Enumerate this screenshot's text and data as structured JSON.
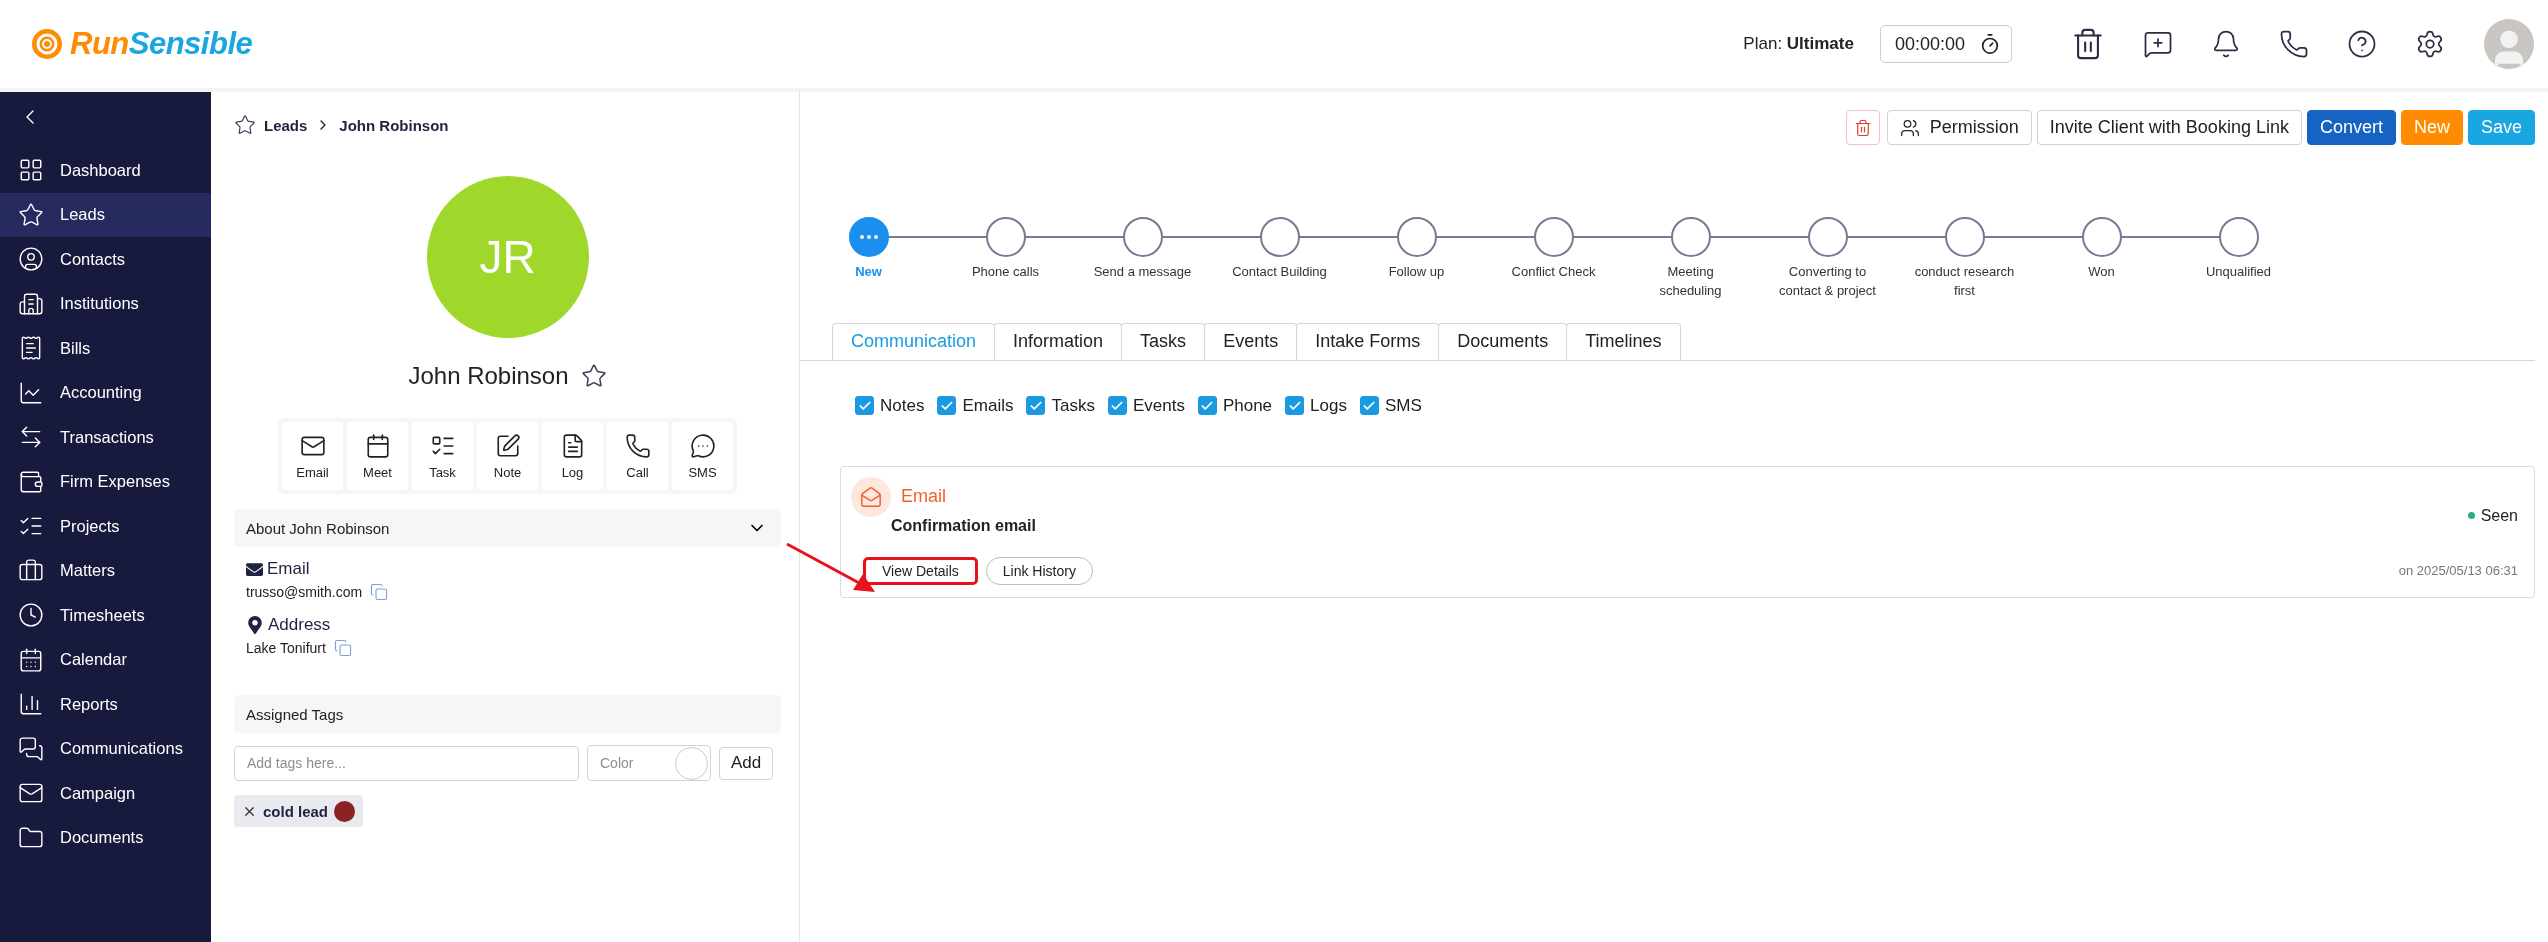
{
  "header": {
    "logo": {
      "part_1": "Run",
      "part_2": "Sensible"
    },
    "plan_label": "Plan:",
    "plan_name": "Ultimate",
    "timer": "00:00:00"
  },
  "sidebar": {
    "items": [
      {
        "label": "Dashboard",
        "selected": false
      },
      {
        "label": "Leads",
        "selected": true
      },
      {
        "label": "Contacts",
        "selected": false
      },
      {
        "label": "Institutions",
        "selected": false
      },
      {
        "label": "Bills",
        "selected": false
      },
      {
        "label": "Accounting",
        "selected": false
      },
      {
        "label": "Transactions",
        "selected": false
      },
      {
        "label": "Firm Expenses",
        "selected": false
      },
      {
        "label": "Projects",
        "selected": false
      },
      {
        "label": "Matters",
        "selected": false
      },
      {
        "label": "Timesheets",
        "selected": false
      },
      {
        "label": "Calendar",
        "selected": false
      },
      {
        "label": "Reports",
        "selected": false
      },
      {
        "label": "Communications",
        "selected": false
      },
      {
        "label": "Campaign",
        "selected": false
      },
      {
        "label": "Documents",
        "selected": false
      }
    ]
  },
  "breadcrumb": [
    "Leads",
    "John Robinson"
  ],
  "profile": {
    "initials": "JR",
    "name": "John Robinson",
    "favorite": false
  },
  "quick_actions": [
    "Email",
    "Meet",
    "Task",
    "Note",
    "Log",
    "Call",
    "SMS"
  ],
  "about": {
    "title": "About John Robinson",
    "expanded": true,
    "fields": [
      {
        "kind": "email",
        "label": "Email",
        "value": "trusso@smith.com"
      },
      {
        "kind": "address",
        "label": "Address",
        "value": "Lake Tonifurt"
      }
    ]
  },
  "tags": {
    "title": "Assigned Tags",
    "placeholder": "Add tags here...",
    "color_placeholder": "Color",
    "add_button": "Add",
    "items": [
      {
        "label": "cold lead",
        "color": "#8b2323"
      }
    ]
  },
  "toolbar": {
    "buttons": [
      {
        "kind": "permission",
        "label": "Permission"
      },
      {
        "kind": "outline",
        "label": "Invite Client with Booking Link"
      },
      {
        "kind": "convert",
        "label": "Convert"
      },
      {
        "kind": "new",
        "label": "New"
      },
      {
        "kind": "save",
        "label": "Save"
      }
    ]
  },
  "stages": [
    {
      "label": "New",
      "selected": true
    },
    {
      "label": "Phone calls",
      "selected": false
    },
    {
      "label": "Send a message",
      "selected": false
    },
    {
      "label": "Contact Building",
      "selected": false
    },
    {
      "label": "Follow up",
      "selected": false
    },
    {
      "label": "Conflict Check",
      "selected": false
    },
    {
      "label": "Meeting scheduling",
      "selected": false
    },
    {
      "label": "Converting to contact & project",
      "selected": false
    },
    {
      "label": "conduct research first",
      "selected": false
    },
    {
      "label": "Won",
      "selected": false
    },
    {
      "label": "Unqualified",
      "selected": false
    }
  ],
  "tabs": [
    {
      "label": "Communication",
      "selected": true
    },
    {
      "label": "Information",
      "selected": false
    },
    {
      "label": "Tasks",
      "selected": false
    },
    {
      "label": "Events",
      "selected": false
    },
    {
      "label": "Intake Forms",
      "selected": false
    },
    {
      "label": "Documents",
      "selected": false
    },
    {
      "label": "Timelines",
      "selected": false
    }
  ],
  "filters": [
    {
      "label": "Notes",
      "checked": true
    },
    {
      "label": "Emails",
      "checked": true
    },
    {
      "label": "Tasks",
      "checked": true
    },
    {
      "label": "Events",
      "checked": true
    },
    {
      "label": "Phone",
      "checked": true
    },
    {
      "label": "Logs",
      "checked": true
    },
    {
      "label": "SMS",
      "checked": true
    }
  ],
  "activities": [
    {
      "type": "Email",
      "subject": "Confirmation email",
      "status": "Seen",
      "timestamp": "on 2025/05/13 06:31",
      "buttons": [
        {
          "label": "View Details",
          "highlighted": true
        },
        {
          "label": "Link History",
          "highlighted": false
        }
      ]
    }
  ]
}
